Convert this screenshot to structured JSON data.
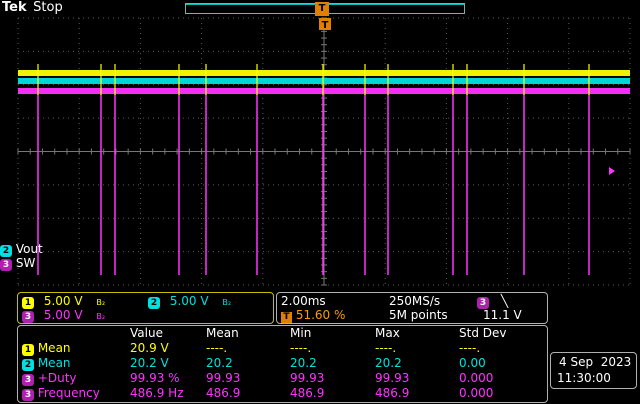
{
  "header": {
    "brand": "Tek",
    "status": "Stop"
  },
  "trigger_marker": "T",
  "channels": {
    "ch2": {
      "num": "2",
      "label": "Vout"
    },
    "ch3": {
      "num": "3",
      "label": "SW"
    }
  },
  "vertical": {
    "ch1": {
      "num": "1",
      "scale": "5.00 V",
      "bw": "B₂"
    },
    "ch2": {
      "num": "2",
      "scale": "5.00 V",
      "bw": "B₂"
    },
    "ch3": {
      "num": "3",
      "scale": "5.00 V",
      "bw": "B₂"
    }
  },
  "horizontal": {
    "timebase": "2.00ms",
    "sample_rate": "250MS/s",
    "trigger_pos": "51.60 %",
    "record_len": "5M points",
    "trig_channel": "3",
    "trig_slope": "╲",
    "trig_level": "11.1 V"
  },
  "measurements": {
    "headers": [
      "Value",
      "Mean",
      "Min",
      "Max",
      "Std Dev"
    ],
    "rows": [
      {
        "num": "1",
        "name": "Mean",
        "value": "20.9 V",
        "mean": "----.",
        "min": "----.",
        "max": "----.",
        "std": "----."
      },
      {
        "num": "2",
        "name": "Mean",
        "value": "20.2 V",
        "mean": "20.2",
        "min": "20.2",
        "max": "20.2",
        "std": "0.00"
      },
      {
        "num": "3",
        "name": "+Duty",
        "value": "99.93 %",
        "mean": "99.93",
        "min": "99.93",
        "max": "99.93",
        "std": "0.000"
      },
      {
        "num": "3",
        "name": "Frequency",
        "value": "486.9 Hz",
        "mean": "486.9",
        "min": "486.9",
        "max": "486.9",
        "std": "0.000"
      }
    ]
  },
  "datetime": {
    "date": "4 Sep  2023",
    "time": "11:30:00"
  },
  "colors": {
    "ch1": "#ffff00",
    "ch2": "#00e0e0",
    "ch3": "#ff33ff",
    "grid": "#5a5a5a"
  }
}
